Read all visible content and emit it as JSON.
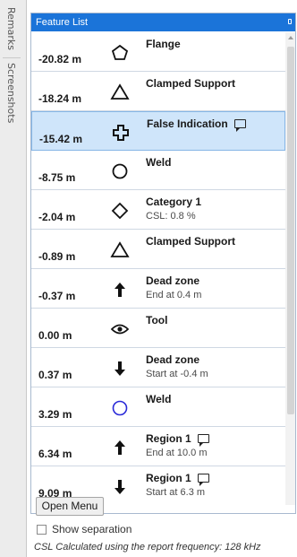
{
  "side_tabs": {
    "remarks": "Remarks",
    "screenshots": "Screenshots"
  },
  "panel": {
    "title": "Feature List"
  },
  "features": [
    {
      "value": "-20.82 m",
      "icon": "pentagon-icon",
      "title": "Flange",
      "sub": "",
      "comment": false
    },
    {
      "value": "-18.24 m",
      "icon": "triangle-icon",
      "title": "Clamped Support",
      "sub": "",
      "comment": false
    },
    {
      "value": "-15.42 m",
      "icon": "cross-icon",
      "title": "False Indication",
      "sub": "",
      "comment": true,
      "selected": true
    },
    {
      "value": "-8.75 m",
      "icon": "circle-icon",
      "title": "Weld",
      "sub": "",
      "comment": false
    },
    {
      "value": "-2.04 m",
      "icon": "diamond-icon",
      "title": "Category 1",
      "sub": "CSL: 0.8 %",
      "comment": false
    },
    {
      "value": "-0.89 m",
      "icon": "triangle-icon",
      "title": "Clamped Support",
      "sub": "",
      "comment": false
    },
    {
      "value": "-0.37 m",
      "icon": "arrow-up-icon",
      "title": "Dead zone",
      "sub": "End at 0.4 m",
      "comment": false
    },
    {
      "value": "0.00 m",
      "icon": "eye-icon",
      "title": "Tool",
      "sub": "",
      "comment": false
    },
    {
      "value": "0.37 m",
      "icon": "arrow-down-icon",
      "title": "Dead zone",
      "sub": "Start at -0.4 m",
      "comment": false
    },
    {
      "value": "3.29 m",
      "icon": "circle-blue-icon",
      "title": "Weld",
      "sub": "",
      "comment": false
    },
    {
      "value": "6.34 m",
      "icon": "arrow-up-icon",
      "title": "Region 1",
      "sub": "End at 10.0 m",
      "comment": true
    },
    {
      "value": "9.09 m",
      "icon": "arrow-down-icon",
      "title": "Region 1",
      "sub": "Start at 6.3 m",
      "comment": true
    }
  ],
  "controls": {
    "open_menu": "Open Menu",
    "show_separation": "Show separation",
    "footer_note": "CSL Calculated using the report frequency: 128 kHz"
  },
  "colors": {
    "header": "#1b74d9",
    "selected_row": "#cfe5fa",
    "weld_blue": "#2a2ad8"
  }
}
